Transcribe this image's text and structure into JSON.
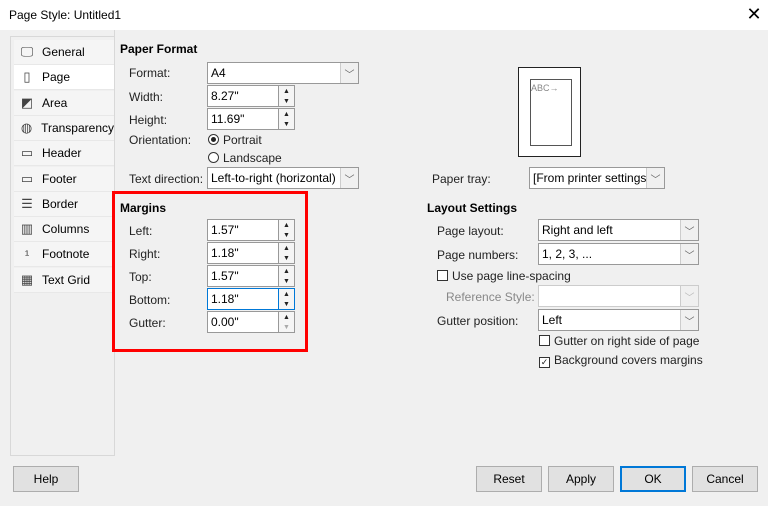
{
  "window": {
    "title": "Page Style: Untitled1",
    "close_icon": "close-icon"
  },
  "sidebar": {
    "items": [
      {
        "label": "General",
        "icon": "general-icon"
      },
      {
        "label": "Page",
        "icon": "page-icon",
        "selected": true
      },
      {
        "label": "Area",
        "icon": "area-icon"
      },
      {
        "label": "Transparency",
        "icon": "transparency-icon"
      },
      {
        "label": "Header",
        "icon": "header-icon"
      },
      {
        "label": "Footer",
        "icon": "footer-icon"
      },
      {
        "label": "Border",
        "icon": "border-icon"
      },
      {
        "label": "Columns",
        "icon": "columns-icon"
      },
      {
        "label": "Footnote",
        "icon": "footnote-icon"
      },
      {
        "label": "Text Grid",
        "icon": "text-grid-icon"
      }
    ]
  },
  "paper_format": {
    "heading": "Paper Format",
    "format_label": "Format:",
    "format_value": "A4",
    "width_label": "Width:",
    "width_value": "8.27\"",
    "height_label": "Height:",
    "height_value": "11.69\"",
    "orientation_label": "Orientation:",
    "portrait": "Portrait",
    "landscape": "Landscape",
    "orientation_selected": "Portrait",
    "text_direction_label": "Text direction:",
    "text_direction_value": "Left-to-right (horizontal)",
    "paper_tray_label": "Paper tray:",
    "paper_tray_value": "[From printer settings]",
    "preview_text": "ABC→"
  },
  "margins": {
    "heading": "Margins",
    "left_label": "Left:",
    "left_value": "1.57\"",
    "right_label": "Right:",
    "right_value": "1.18\"",
    "top_label": "Top:",
    "top_value": "1.57\"",
    "bottom_label": "Bottom:",
    "bottom_value": "1.18\"",
    "gutter_label": "Gutter:",
    "gutter_value": "0.00\"",
    "highlight_color": "#ff0000"
  },
  "layout": {
    "heading": "Layout Settings",
    "page_layout_label": "Page layout:",
    "page_layout_value": "Right and left",
    "page_numbers_label": "Page numbers:",
    "page_numbers_value": "1, 2, 3, ...",
    "use_line_spacing_label": "Use page line-spacing",
    "use_line_spacing_checked": false,
    "reference_style_label": "Reference Style:",
    "reference_style_value": "",
    "gutter_position_label": "Gutter position:",
    "gutter_position_value": "Left",
    "gutter_right_label": "Gutter on right side of page",
    "gutter_right_checked": false,
    "background_covers_label": "Background covers margins",
    "background_covers_checked": true
  },
  "buttons": {
    "help": "Help",
    "reset": "Reset",
    "apply": "Apply",
    "ok": "OK",
    "cancel": "Cancel"
  }
}
